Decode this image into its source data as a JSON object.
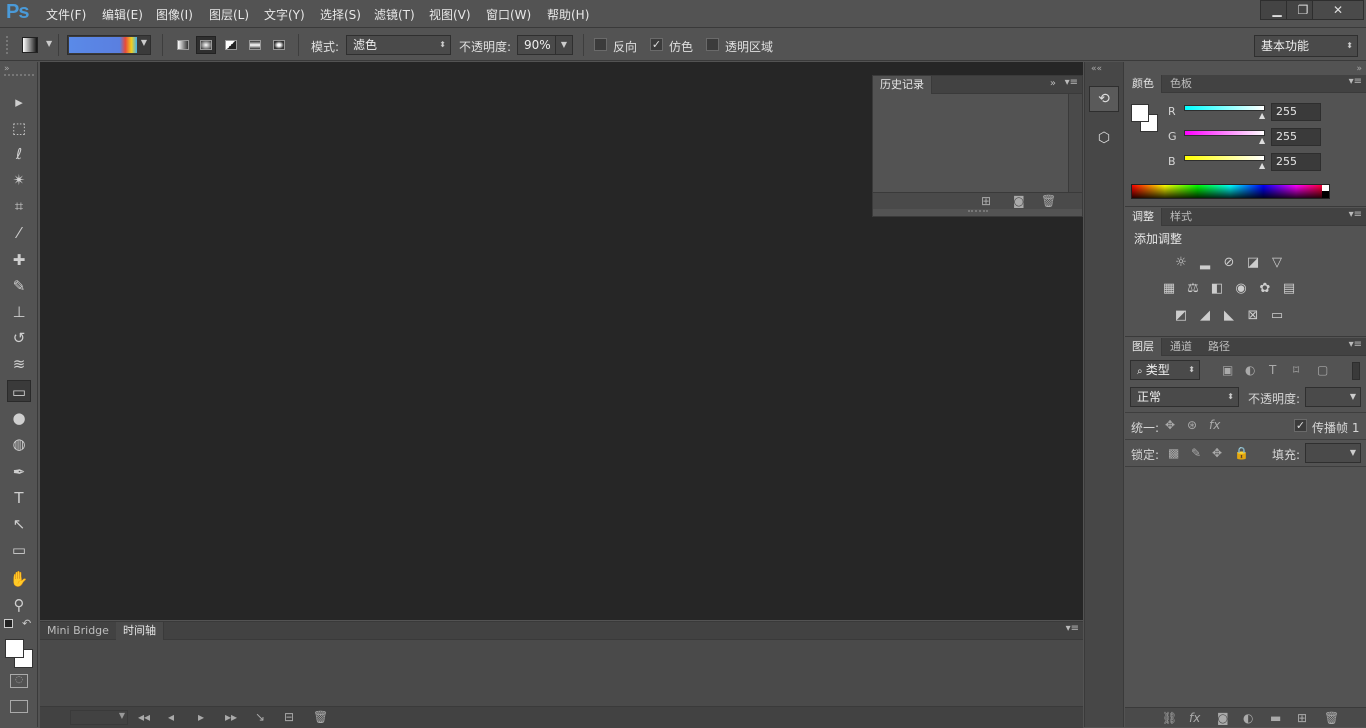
{
  "app": {
    "logo": "Ps"
  },
  "menu": [
    "文件(F)",
    "编辑(E)",
    "图像(I)",
    "图层(L)",
    "文字(Y)",
    "选择(S)",
    "滤镜(T)",
    "视图(V)",
    "窗口(W)",
    "帮助(H)"
  ],
  "window_controls": {
    "minimize": "▁",
    "restore": "❐",
    "close": "✕"
  },
  "options": {
    "mode_label": "模式:",
    "mode_value": "滤色",
    "opacity_label": "不透明度:",
    "opacity_value": "90%",
    "reverse_label": "反向",
    "reverse_checked": false,
    "dither_label": "仿色",
    "dither_checked": true,
    "transparency_label": "透明区域",
    "transparency_checked": false,
    "workspace": "基本功能"
  },
  "tools": [
    {
      "name": "move-tool-icon",
      "glyph": "▸"
    },
    {
      "name": "marquee-tool-icon",
      "glyph": "⬚"
    },
    {
      "name": "lasso-tool-icon",
      "glyph": "ℓ"
    },
    {
      "name": "magic-wand-tool-icon",
      "glyph": "✴"
    },
    {
      "name": "crop-tool-icon",
      "glyph": "⌗"
    },
    {
      "name": "eyedropper-tool-icon",
      "glyph": "⁄"
    },
    {
      "name": "healing-brush-tool-icon",
      "glyph": "✚"
    },
    {
      "name": "brush-tool-icon",
      "glyph": "✎"
    },
    {
      "name": "clone-stamp-tool-icon",
      "glyph": "⊥"
    },
    {
      "name": "history-brush-tool-icon",
      "glyph": "↺"
    },
    {
      "name": "eraser-tool-icon",
      "glyph": "≋"
    },
    {
      "name": "gradient-tool-icon",
      "glyph": "▭"
    },
    {
      "name": "blur-tool-icon",
      "glyph": "●"
    },
    {
      "name": "dodge-tool-icon",
      "glyph": "◍"
    },
    {
      "name": "pen-tool-icon",
      "glyph": "✒"
    },
    {
      "name": "type-tool-icon",
      "glyph": "T"
    },
    {
      "name": "path-selection-tool-icon",
      "glyph": "↖"
    },
    {
      "name": "shape-tool-icon",
      "glyph": "▭"
    },
    {
      "name": "hand-tool-icon",
      "glyph": "✋"
    },
    {
      "name": "zoom-tool-icon",
      "glyph": "⚲"
    }
  ],
  "history": {
    "tab": "历史记录"
  },
  "timeline": {
    "tabs": [
      "Mini Bridge",
      "时间轴"
    ]
  },
  "color_panel": {
    "tabs": [
      "颜色",
      "色板"
    ],
    "r_label": "R",
    "g_label": "G",
    "b_label": "B",
    "r": "255",
    "g": "255",
    "b": "255"
  },
  "adjustments": {
    "tabs": [
      "调整",
      "样式"
    ],
    "title": "添加调整"
  },
  "layers": {
    "tabs": [
      "图层",
      "通道",
      "路径"
    ],
    "filter": "类型",
    "blend": "正常",
    "opacity_label": "不透明度:",
    "unify_label": "统一:",
    "propagate_label": "传播帧 1",
    "lock_label": "锁定:",
    "fill_label": "填充:"
  },
  "colors": {
    "accent": "#4a9ad8",
    "canvas": "#262626",
    "chrome": "#535353"
  }
}
